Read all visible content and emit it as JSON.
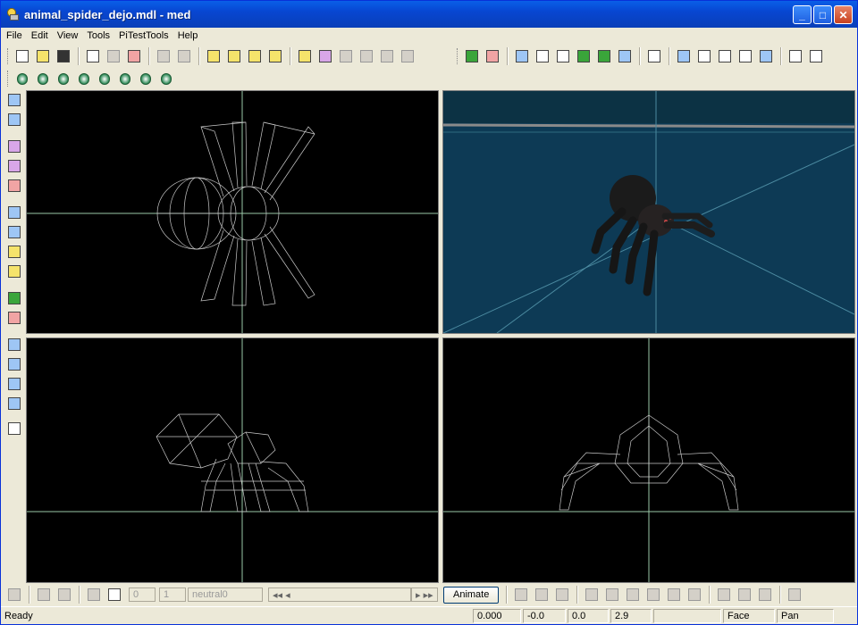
{
  "window": {
    "title": "animal_spider_dejo.mdl - med",
    "minimize": "_",
    "maximize": "□",
    "close": "✕"
  },
  "menu": [
    "File",
    "Edit",
    "View",
    "Tools",
    "PiTestTools",
    "Help"
  ],
  "anim": {
    "frame_start": "0",
    "frame_end": "1",
    "animation_name": "neutral0",
    "animate_label": "Animate"
  },
  "status": {
    "ready": "Ready",
    "x": "0.000",
    "y": "-0.0",
    "z": "0.0",
    "zoom": "2.9",
    "mode_select": "Face",
    "mode_view": "Pan"
  },
  "colors": {
    "viewport_bg": "#000000",
    "perspective_bg": "#0d3a55",
    "wire": "#c8c8c8",
    "axis": "#9ac8a8",
    "titlebar": "#0a5fe8"
  },
  "icons": {
    "toolbar1": [
      "new-icon",
      "open-icon",
      "save-icon",
      "copy-icon",
      "paste-icon",
      "delete-icon",
      "undo-icon",
      "redo-icon",
      "select-vertex-icon",
      "select-edge-icon",
      "select-face-icon",
      "select-object-icon",
      "hierarchy-icon",
      "bounding-box-icon",
      "view-front-icon",
      "view-side-icon",
      "view-top-icon",
      "view-persp-icon",
      "add-node-icon",
      "add-triangle-icon",
      "mirror-icon",
      "scale-icon",
      "weld-icon",
      "align-icon",
      "split-icon",
      "flip-icon",
      "magnet-icon",
      "rotate-view-icon",
      "walk-icon",
      "hand-icon",
      "light-icon",
      "camera-icon",
      "fit-icon",
      "move-icon"
    ],
    "toolbar2": [
      "box-icon",
      "sphere-icon",
      "cylinder-icon",
      "torus-icon",
      "tube-icon",
      "cone-icon",
      "pyramid-icon",
      "gem-icon"
    ],
    "left": [
      "move-tool-icon",
      "rotate-tool-icon",
      "scale-tool-icon",
      "extrude-tool-icon",
      "target-tool-icon",
      "cut-tool-icon",
      "slice-tool-icon",
      "paint-tool-icon",
      "uv-tool-icon",
      "group-tool-icon",
      "ungroup-tool-icon",
      "grid-1-icon",
      "grid-2-icon",
      "grid-3-icon",
      "grid-4-icon",
      "grid-5-icon"
    ]
  }
}
